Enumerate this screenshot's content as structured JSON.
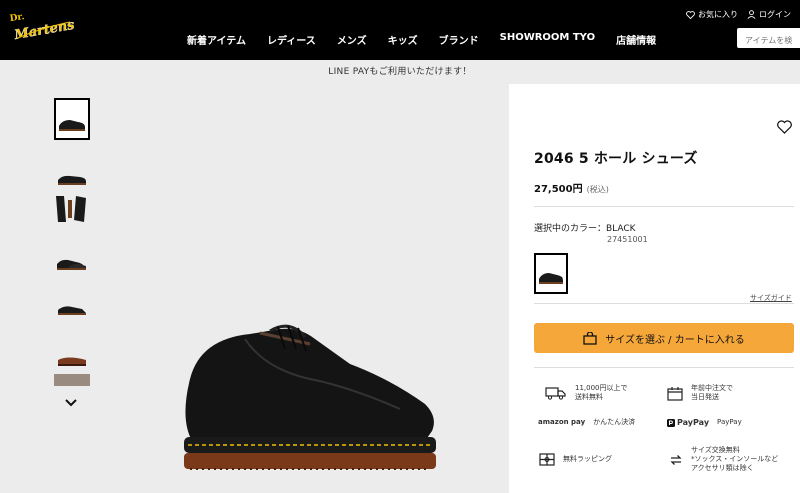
{
  "header": {
    "logo_text": "Dr. Martens",
    "wishlist_label": "お気に入り",
    "login_label": "ログイン",
    "search_placeholder": "アイテムを検",
    "nav": [
      "新着アイテム",
      "レディース",
      "メンズ",
      "キッズ",
      "ブランド",
      "SHOWROOM TYO",
      "店舗情報"
    ]
  },
  "notice": "LINE PAYもご利用いただけます！",
  "product": {
    "title": "2046 5 ホール シューズ",
    "price": "27,500円",
    "tax_note": "(税込)",
    "color_label": "選択中のカラー：BLACK",
    "color_code": "27451001",
    "size_guide": "サイズガイド",
    "cart_button": "サイズを選ぶ / カートに入れる"
  },
  "features": [
    {
      "icon": "truck-icon",
      "text": "11,000円以上で\n送料無料"
    },
    {
      "icon": "calendar-icon",
      "text": "年前中注文で\n当日発送"
    },
    {
      "icon": "amazon-pay-icon",
      "text": "かんたん決済",
      "logo": "amazon pay"
    },
    {
      "icon": "paypay-icon",
      "text": "PayPay",
      "logo": "PayPay"
    },
    {
      "icon": "gift-wrap-icon",
      "text": "無料ラッピング"
    },
    {
      "icon": "exchange-icon",
      "text": "サイズ交換無料\n*ソックス・インソールなど\nアクセサリ類は除く"
    }
  ],
  "colors": {
    "accent": "#f6a73a",
    "header_bg": "#000000",
    "logo_yellow": "#f5c400"
  }
}
